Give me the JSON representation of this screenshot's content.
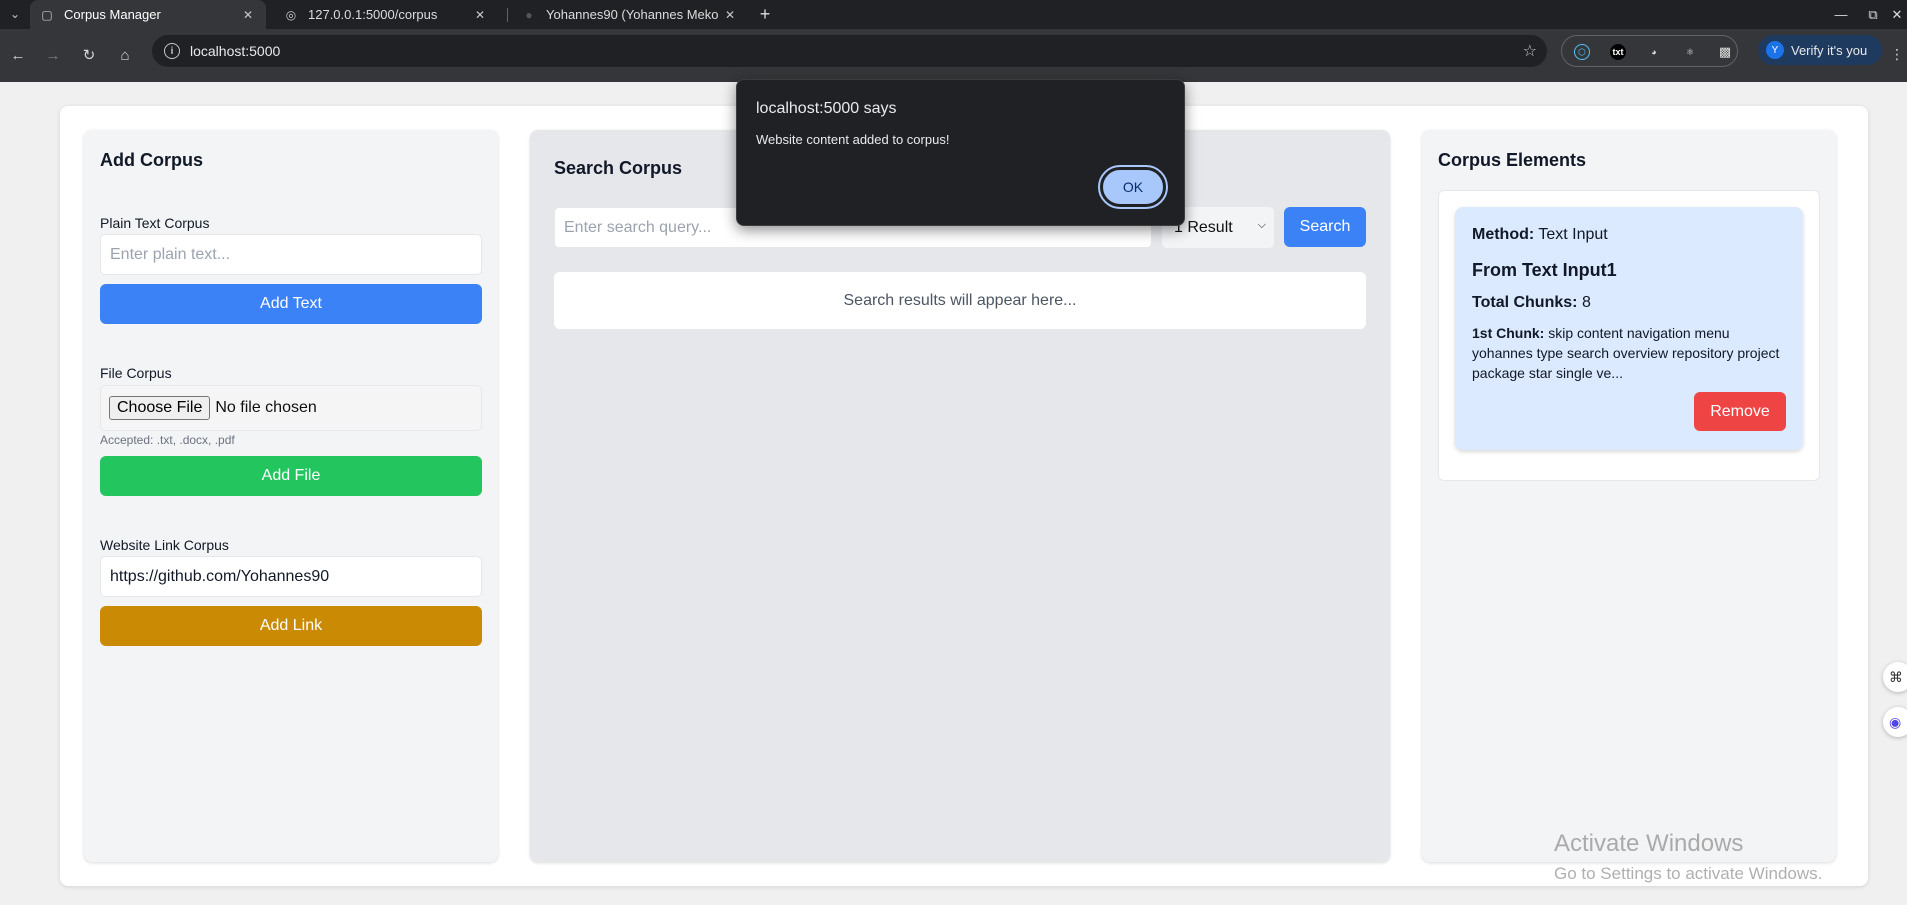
{
  "browser": {
    "tabs": [
      {
        "title": "Corpus Manager",
        "active": true
      },
      {
        "title": "127.0.0.1:5000/corpus",
        "active": false
      },
      {
        "title": "Yohannes90 (Yohannes Meko",
        "active": false
      }
    ],
    "url": "localhost:5000",
    "profile_button": "Verify it's you",
    "profile_initial": "Y"
  },
  "add_corpus": {
    "title": "Add Corpus",
    "plain_text": {
      "label": "Plain Text Corpus",
      "placeholder": "Enter plain text...",
      "button": "Add Text"
    },
    "file": {
      "label": "File Corpus",
      "choose": "Choose File",
      "status": "No file chosen",
      "hint": "Accepted: .txt, .docx, .pdf",
      "button": "Add File"
    },
    "website": {
      "label": "Website Link Corpus",
      "value": "https://github.com/Yohannes90",
      "button": "Add Link"
    }
  },
  "search_corpus": {
    "title": "Search Corpus",
    "placeholder": "Enter search query...",
    "result_count": "1 Result",
    "button": "Search",
    "results_placeholder": "Search results will appear here..."
  },
  "corpus_elements": {
    "title": "Corpus Elements",
    "items": [
      {
        "method_label": "Method:",
        "method": "Text Input",
        "name": "From Text Input1",
        "chunks_label": "Total Chunks:",
        "chunks": "8",
        "first_chunk_label": "1st Chunk:",
        "first_chunk": "skip content navigation menu yohannes type search overview repository project package star single ve...",
        "remove": "Remove"
      }
    ]
  },
  "alert": {
    "title": "localhost:5000 says",
    "message": "Website content added to corpus!",
    "ok": "OK"
  },
  "watermark": {
    "title": "Activate Windows",
    "subtitle": "Go to Settings to activate Windows."
  },
  "colors": {
    "blue": "#3b82f6",
    "green": "#22c55e",
    "gold": "#ca8a04",
    "red": "#ef4444",
    "card": "#dbeafe"
  }
}
